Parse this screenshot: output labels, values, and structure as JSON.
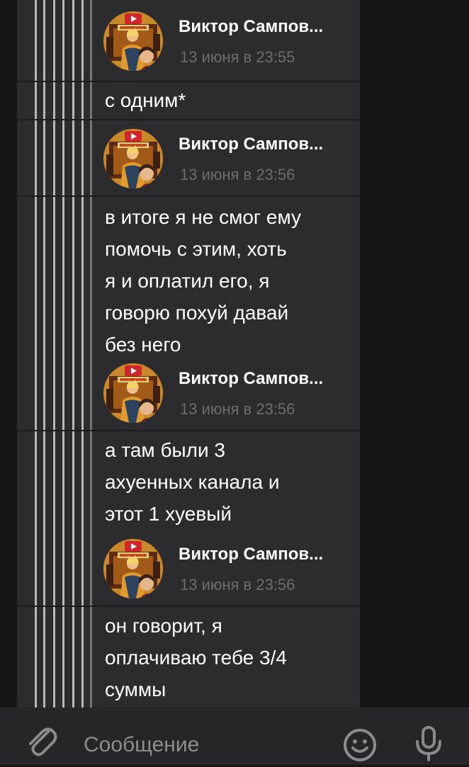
{
  "messages": [
    {
      "sender": "Виктор Сампов...",
      "time": "13 июня в 23:55",
      "text": "с одним*"
    },
    {
      "sender": "Виктор Сампов...",
      "time": "13 июня в 23:56",
      "text": "в итоге я не смог ему\nпомочь с этим, хоть\nя и оплатил его, я\nговорю похуй давай\nбез него"
    },
    {
      "sender": "Виктор Сампов...",
      "time": "13 июня в 23:56",
      "text": "а там были 3\nахуенных канала и\nэтот 1 хуевый"
    },
    {
      "sender": "Виктор Сампов...",
      "time": "13 июня в 23:56",
      "text": "он говорит, я\nоплачиваю тебе 3/4\nсуммы"
    }
  ],
  "input": {
    "placeholder": "Сообщение"
  },
  "icons": {
    "attach": "paperclip-icon",
    "emoji": "smiley-icon",
    "mic": "microphone-icon"
  },
  "colors": {
    "background": "#161616",
    "message_panel": "#2c2c2e",
    "timestamp": "#6d6d70",
    "text": "#ffffff",
    "input_bar": "#262628"
  }
}
